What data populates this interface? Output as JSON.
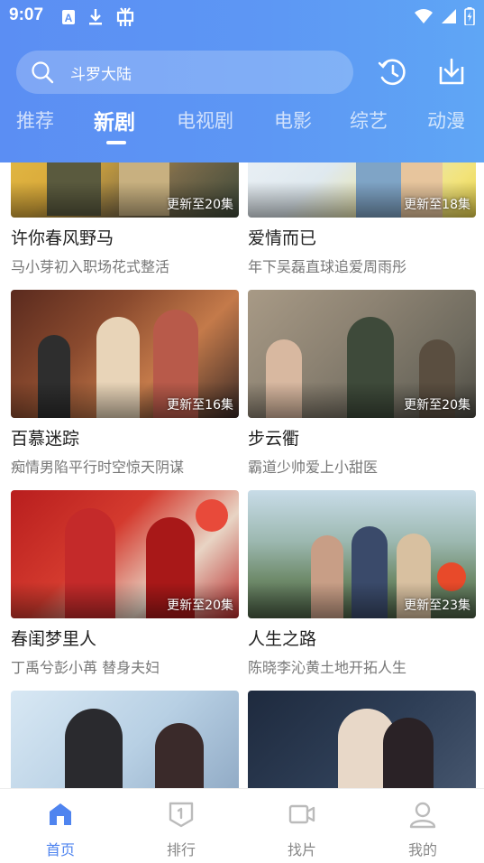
{
  "status_bar": {
    "time": "9:07",
    "left_icons": [
      "font-a-icon",
      "download-arrow-icon",
      "bug-icon"
    ],
    "right_icons": [
      "wifi-icon",
      "signal-icon",
      "battery-charging-icon"
    ]
  },
  "header": {
    "search": {
      "placeholder": "斗罗大陆"
    },
    "actions": [
      "history-icon",
      "download-icon"
    ],
    "tabs": [
      {
        "label": "推荐"
      },
      {
        "label": "新剧",
        "active": true
      },
      {
        "label": "电视剧"
      },
      {
        "label": "电影"
      },
      {
        "label": "综艺"
      },
      {
        "label": "动漫"
      }
    ]
  },
  "colors": {
    "accent": "#4f84ef",
    "header_gradient_start": "#5b8ef3",
    "header_gradient_end": "#5fa6f5"
  },
  "shows": [
    {
      "title": "许你春风野马",
      "subtitle": "马小芽初入职场花式整活",
      "badge": "更新至20集"
    },
    {
      "title": "爱情而已",
      "subtitle": "年下吴磊直球追爱周雨彤",
      "badge": "更新至18集"
    },
    {
      "title": "百慕迷踪",
      "subtitle": "痴情男陷平行时空惊天阴谋",
      "badge": "更新至16集"
    },
    {
      "title": "步云衢",
      "subtitle": "霸道少帅爱上小甜医",
      "badge": "更新至20集"
    },
    {
      "title": "春闺梦里人",
      "subtitle": "丁禹兮彭小苒 替身夫妇",
      "badge": "更新至20集"
    },
    {
      "title": "人生之路",
      "subtitle": "陈晓李沁黄土地开拓人生",
      "badge": "更新至23集"
    },
    {
      "title": "",
      "subtitle": "",
      "badge": ""
    },
    {
      "title": "",
      "subtitle": "",
      "badge": ""
    }
  ],
  "bottom_nav": [
    {
      "label": "首页",
      "icon": "home-icon",
      "active": true
    },
    {
      "label": "排行",
      "icon": "ranking-icon"
    },
    {
      "label": "找片",
      "icon": "video-camera-icon"
    },
    {
      "label": "我的",
      "icon": "profile-icon"
    }
  ]
}
